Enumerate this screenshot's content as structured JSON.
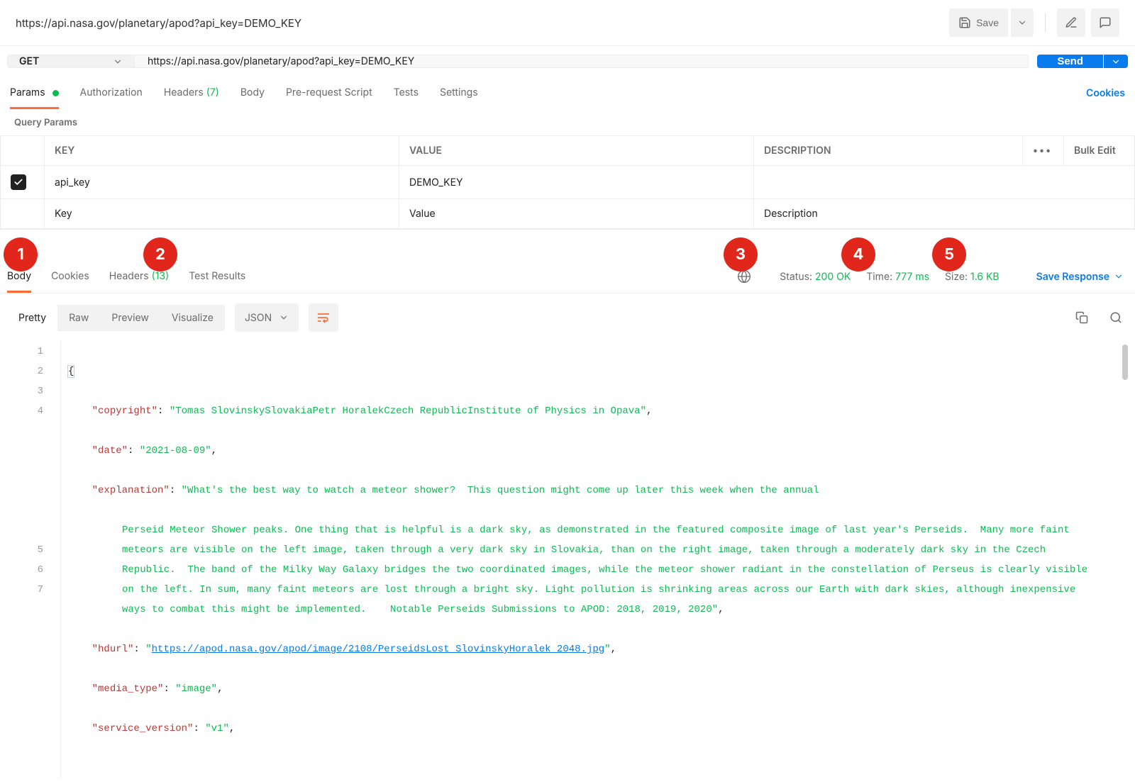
{
  "title": "https://api.nasa.gov/planetary/apod?api_key=DEMO_KEY",
  "toolbar": {
    "save_label": "Save"
  },
  "request": {
    "method": "GET",
    "url": "https://api.nasa.gov/planetary/apod?api_key=DEMO_KEY",
    "send_label": "Send",
    "tabs": {
      "params": "Params",
      "auth": "Authorization",
      "headers_label": "Headers",
      "headers_count": "(7)",
      "body": "Body",
      "prereq": "Pre-request Script",
      "tests": "Tests",
      "settings": "Settings"
    },
    "cookies_link": "Cookies",
    "section_label": "Query Params",
    "table": {
      "headers": {
        "key": "KEY",
        "value": "VALUE",
        "desc": "DESCRIPTION",
        "bulk": "Bulk Edit"
      },
      "rows": [
        {
          "checked": true,
          "key": "api_key",
          "value": "DEMO_KEY",
          "desc": ""
        }
      ],
      "placeholders": {
        "key": "Key",
        "value": "Value",
        "desc": "Description"
      }
    }
  },
  "response": {
    "tabs": {
      "body": "Body",
      "cookies": "Cookies",
      "headers_label": "Headers",
      "headers_count": "(13)",
      "test_results": "Test Results"
    },
    "meta": {
      "status_label": "Status:",
      "status_value": "200 OK",
      "time_label": "Time:",
      "time_value": "777 ms",
      "size_label": "Size:",
      "size_value": "1.6 KB",
      "save_response": "Save Response"
    },
    "viewer": {
      "modes": {
        "pretty": "Pretty",
        "raw": "Raw",
        "preview": "Preview",
        "visualize": "Visualize"
      },
      "format": "JSON"
    },
    "json": {
      "copyright_key": "\"copyright\"",
      "copyright_val": "\"Tomas SlovinskySlovakiaPetr HoralekCzech RepublicInstitute of Physics in Opava\"",
      "date_key": "\"date\"",
      "date_val": "\"2021-08-09\"",
      "explanation_key": "\"explanation\"",
      "explanation_val_open": "\"What's the best way to watch a meteor shower?  This question might come up later this week when the annual",
      "explanation_cont": "Perseid Meteor Shower peaks. One thing that is helpful is a dark sky, as demonstrated in the featured composite image of last year's Perseids.  Many more faint meteors are visible on the left image, taken through a very dark sky in Slovakia, than on the right image, taken through a moderately dark sky in the Czech Republic.  The band of the Milky Way Galaxy bridges the two coordinated images, while the meteor shower radiant in the constellation of Perseus is clearly visible on the left. In sum, many faint meteors are lost through a bright sky. Light pollution is shrinking areas across our Earth with dark skies, although inexpensive ways to combat this might be implemented.    Notable Perseids Submissions to APOD: 2018, 2019, 2020\"",
      "hdurl_key": "\"hdurl\"",
      "hdurl_quote_open": "\"",
      "hdurl_link": "https://apod.nasa.gov/apod/image/2108/PerseidsLost_SlovinskyHoralek_2048.jpg",
      "hdurl_quote_close": "\"",
      "media_type_key": "\"media_type\"",
      "media_type_val": "\"image\"",
      "service_version_key": "\"service_version\"",
      "service_version_val": "\"v1\""
    }
  },
  "badges": {
    "b1": "1",
    "b2": "2",
    "b3": "3",
    "b4": "4",
    "b5": "5"
  }
}
